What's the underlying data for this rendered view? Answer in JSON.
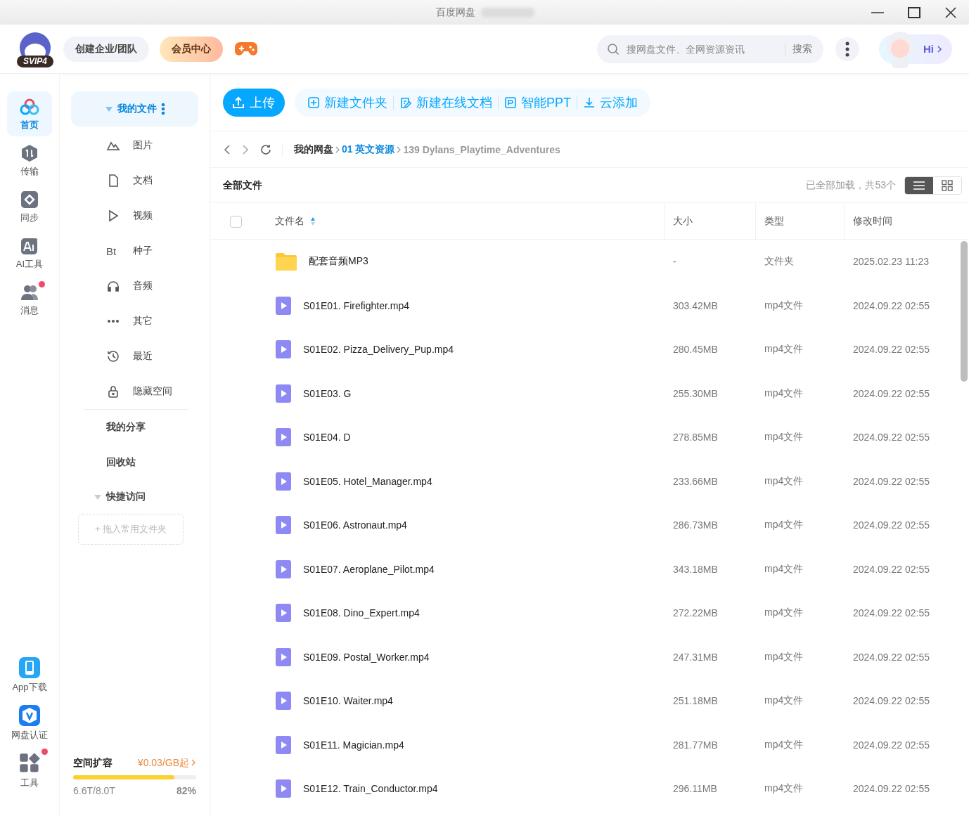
{
  "window": {
    "title": "百度网盘"
  },
  "header": {
    "badge": "SVIP4",
    "buttons": [
      {
        "label": "创建企业/团队",
        "kind": "plain"
      },
      {
        "label": "会员中心",
        "kind": "vip"
      }
    ],
    "search": {
      "placeholder": "搜网盘文件、全网资源资讯",
      "button": "搜索"
    },
    "greeting": "Hi"
  },
  "rail": {
    "items": [
      {
        "label": "首页",
        "selected": true,
        "dot": false
      },
      {
        "label": "传输",
        "selected": false,
        "dot": false
      },
      {
        "label": "同步",
        "selected": false,
        "dot": false
      },
      {
        "label": "AI工具",
        "selected": false,
        "dot": false
      },
      {
        "label": "消息",
        "selected": false,
        "dot": true
      }
    ],
    "bottom": [
      {
        "label": "App下载",
        "dot": false
      },
      {
        "label": "网盘认证",
        "dot": false
      },
      {
        "label": "工具",
        "dot": true
      }
    ]
  },
  "sidebar": {
    "my_files": {
      "label": "我的文件",
      "expanded": true,
      "selected": true
    },
    "categories": [
      {
        "label": "图片",
        "kind": "icon"
      },
      {
        "label": "文档",
        "kind": "icon"
      },
      {
        "label": "视频",
        "kind": "icon"
      },
      {
        "label": "种子",
        "kind": "text",
        "symbol": "Bt"
      },
      {
        "label": "音频",
        "kind": "icon"
      },
      {
        "label": "其它",
        "kind": "icon"
      },
      {
        "label": "最近",
        "kind": "icon"
      },
      {
        "label": "隐藏空间",
        "kind": "icon"
      }
    ],
    "links": [
      "我的分享",
      "回收站"
    ],
    "quick_access": {
      "label": "快捷访问",
      "expanded": true,
      "drop_hint": "+ 拖入常用文件夹"
    },
    "storage": {
      "title": "空间扩容",
      "price": "¥0.03/GB起",
      "level": 0.82,
      "used": "6.6T/8.0T",
      "percent": "82%"
    }
  },
  "toolbar": {
    "upload": "上传",
    "actions": [
      "新建文件夹",
      "新建在线文档",
      "智能PPT",
      "云添加"
    ]
  },
  "breadcrumb": [
    "我的网盘",
    "01 英文资源",
    "139 Dylans_Playtime_Adventures"
  ],
  "list": {
    "title": "全部文件",
    "count": "已全部加载，共53个",
    "views": [
      {
        "kind": "list",
        "selected": true
      },
      {
        "kind": "grid",
        "selected": false
      }
    ],
    "select_all": {
      "checked": false
    },
    "columns": [
      "文件名",
      "大小",
      "类型",
      "修改时间"
    ],
    "rows": [
      {
        "kind": "folder",
        "name": "配套音频MP3",
        "size": "-",
        "type": "文件夹",
        "modified": "2025.02.23 11:23"
      },
      {
        "kind": "video",
        "name": "S01E01. Firefighter.mp4",
        "size": "303.42MB",
        "type": "mp4文件",
        "modified": "2024.09.22 02:55"
      },
      {
        "kind": "video",
        "name": "S01E02. Pizza_Delivery_Pup.mp4",
        "size": "280.45MB",
        "type": "mp4文件",
        "modified": "2024.09.22 02:55"
      },
      {
        "kind": "video",
        "name": "S01E03. G",
        "size": "255.30MB",
        "type": "mp4文件",
        "modified": "2024.09.22 02:55"
      },
      {
        "kind": "video",
        "name": "S01E04. D",
        "size": "278.85MB",
        "type": "mp4文件",
        "modified": "2024.09.22 02:55"
      },
      {
        "kind": "video",
        "name": "S01E05. Hotel_Manager.mp4",
        "size": "233.66MB",
        "type": "mp4文件",
        "modified": "2024.09.22 02:55"
      },
      {
        "kind": "video",
        "name": "S01E06. Astronaut.mp4",
        "size": "286.73MB",
        "type": "mp4文件",
        "modified": "2024.09.22 02:55"
      },
      {
        "kind": "video",
        "name": "S01E07. Aeroplane_Pilot.mp4",
        "size": "343.18MB",
        "type": "mp4文件",
        "modified": "2024.09.22 02:55"
      },
      {
        "kind": "video",
        "name": "S01E08. Dino_Expert.mp4",
        "size": "272.22MB",
        "type": "mp4文件",
        "modified": "2024.09.22 02:55"
      },
      {
        "kind": "video",
        "name": "S01E09. Postal_Worker.mp4",
        "size": "247.31MB",
        "type": "mp4文件",
        "modified": "2024.09.22 02:55"
      },
      {
        "kind": "video",
        "name": "S01E10. Waiter.mp4",
        "size": "251.18MB",
        "type": "mp4文件",
        "modified": "2024.09.22 02:55"
      },
      {
        "kind": "video",
        "name": "S01E11. Magician.mp4",
        "size": "281.77MB",
        "type": "mp4文件",
        "modified": "2024.09.22 02:55"
      },
      {
        "kind": "video",
        "name": "S01E12. Train_Conductor.mp4",
        "size": "296.11MB",
        "type": "mp4文件",
        "modified": "2024.09.22 02:55"
      }
    ]
  }
}
